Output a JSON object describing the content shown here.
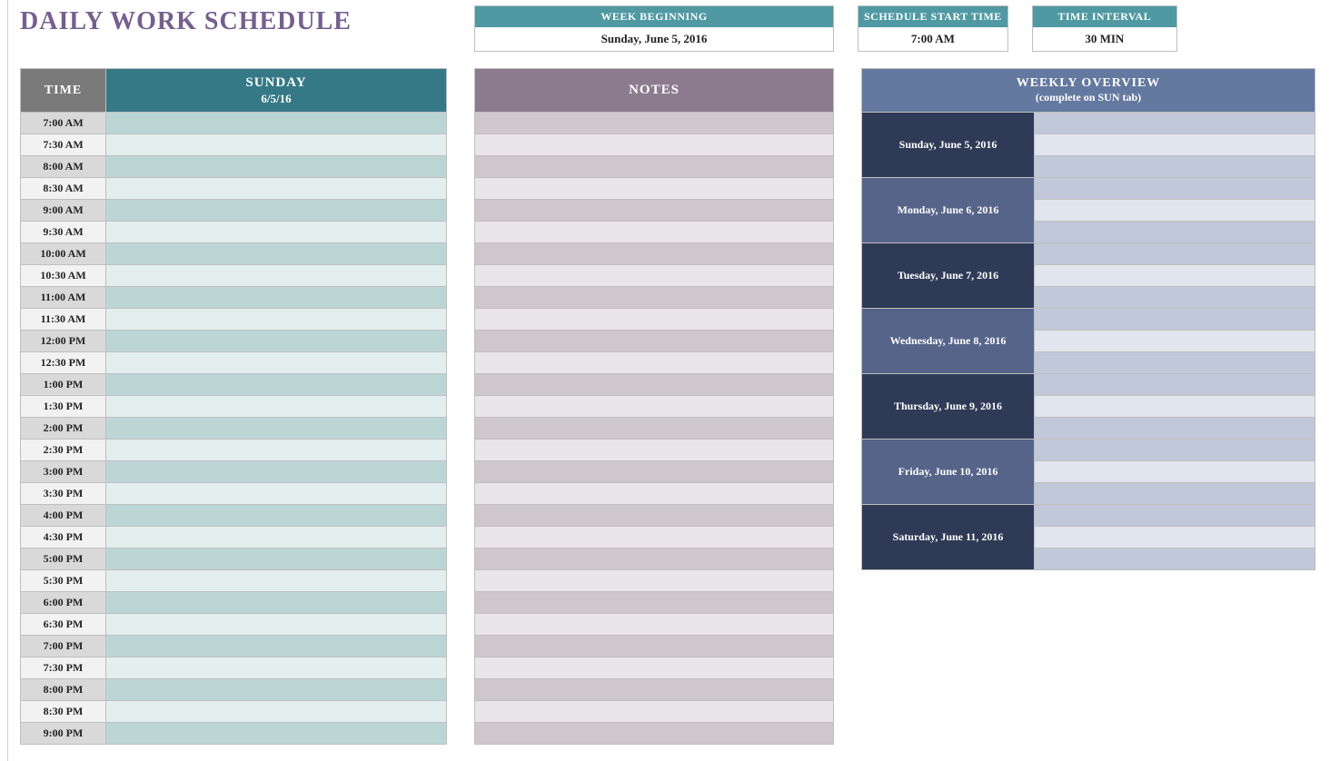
{
  "title": "DAILY WORK SCHEDULE",
  "info": {
    "week_label": "WEEK BEGINNING",
    "week_value": "Sunday, June 5, 2016",
    "start_label": "SCHEDULE START TIME",
    "start_value": "7:00 AM",
    "interval_label": "TIME INTERVAL",
    "interval_value": "30 MIN"
  },
  "schedule": {
    "time_header": "TIME",
    "day_header": "SUNDAY",
    "day_date": "6/5/16",
    "times": [
      "7:00 AM",
      "7:30 AM",
      "8:00 AM",
      "8:30 AM",
      "9:00 AM",
      "9:30 AM",
      "10:00 AM",
      "10:30 AM",
      "11:00 AM",
      "11:30 AM",
      "12:00 PM",
      "12:30 PM",
      "1:00 PM",
      "1:30 PM",
      "2:00 PM",
      "2:30 PM",
      "3:00 PM",
      "3:30 PM",
      "4:00 PM",
      "4:30 PM",
      "5:00 PM",
      "5:30 PM",
      "6:00 PM",
      "6:30 PM",
      "7:00 PM",
      "7:30 PM",
      "8:00 PM",
      "8:30 PM",
      "9:00 PM"
    ],
    "events": [
      "",
      "",
      "",
      "",
      "",
      "",
      "",
      "",
      "",
      "",
      "",
      "",
      "",
      "",
      "",
      "",
      "",
      "",
      "",
      "",
      "",
      "",
      "",
      "",
      "",
      "",
      "",
      "",
      ""
    ]
  },
  "notes": {
    "header": "NOTES",
    "rows": [
      "",
      "",
      "",
      "",
      "",
      "",
      "",
      "",
      "",
      "",
      "",
      "",
      "",
      "",
      "",
      "",
      "",
      "",
      "",
      "",
      "",
      "",
      "",
      "",
      "",
      "",
      "",
      "",
      ""
    ]
  },
  "weekly": {
    "header_title": "WEEKLY OVERVIEW",
    "header_sub": "(complete on SUN tab)",
    "days": [
      "Sunday, June 5, 2016",
      "Monday, June 6, 2016",
      "Tuesday, June 7, 2016",
      "Wednesday, June 8, 2016",
      "Thursday, June 9, 2016",
      "Friday, June 10, 2016",
      "Saturday, June 11, 2016"
    ],
    "entries": [
      [
        "",
        "",
        ""
      ],
      [
        "",
        "",
        ""
      ],
      [
        "",
        "",
        ""
      ],
      [
        "",
        "",
        ""
      ],
      [
        "",
        "",
        ""
      ],
      [
        "",
        "",
        ""
      ],
      [
        "",
        "",
        ""
      ]
    ]
  }
}
